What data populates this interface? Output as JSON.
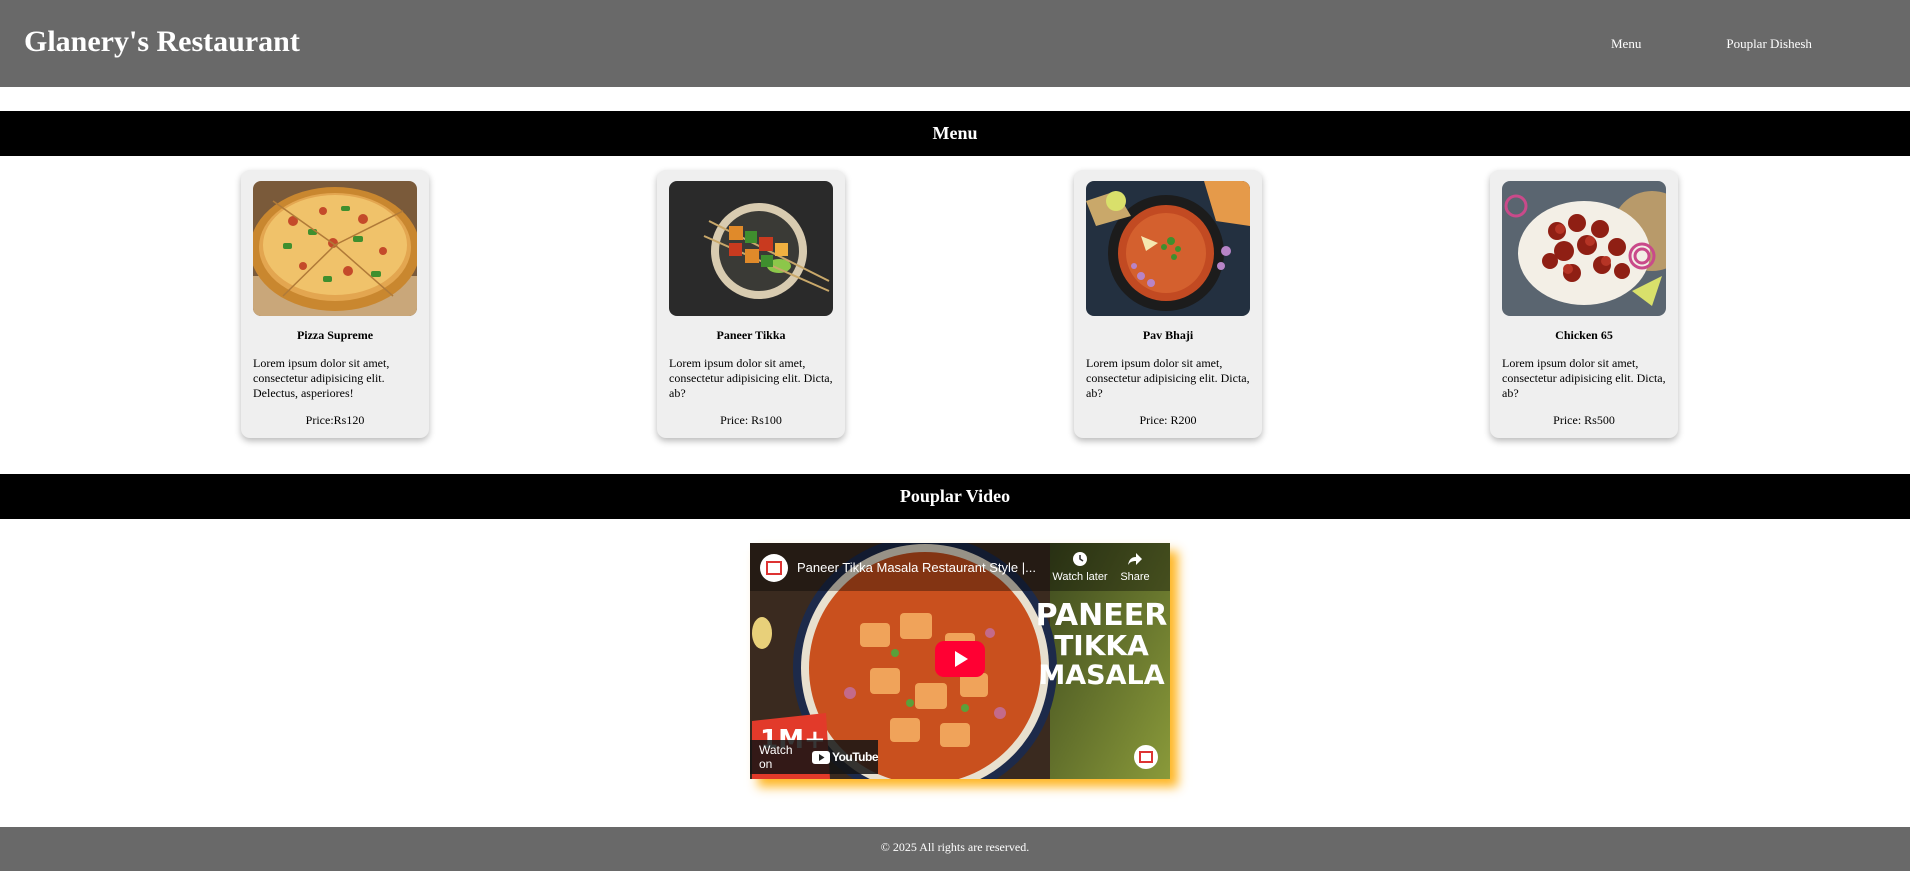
{
  "header": {
    "title": "Glanery's Restaurant",
    "nav": [
      "Menu",
      "Pouplar Dishesh"
    ]
  },
  "menu_section": {
    "heading": "Menu"
  },
  "dishes": [
    {
      "name": "Pizza Supreme",
      "description": "Lorem ipsum dolor sit amet, consectetur adipisicing elit. Delectus, asperiores!",
      "price": "Price:Rs120",
      "image": "pizza-image"
    },
    {
      "name": "Paneer Tikka",
      "description": "Lorem ipsum dolor sit amet, consectetur adipisicing elit. Dicta, ab?",
      "price": "Price: Rs100",
      "image": "paneer-tikka-image"
    },
    {
      "name": "Pav Bhaji",
      "description": "Lorem ipsum dolor sit amet, consectetur adipisicing elit. Dicta, ab?",
      "price": "Price: R200",
      "image": "pav-bhaji-image"
    },
    {
      "name": "Chicken 65",
      "description": "Lorem ipsum dolor sit amet, consectetur adipisicing elit. Dicta, ab?",
      "price": "Price: Rs500",
      "image": "chicken-65-image"
    }
  ],
  "video_section": {
    "heading": "Pouplar Video",
    "video_title": "Paneer Tikka Masala Restaurant Style |...",
    "watch_later": "Watch later",
    "share": "Share",
    "thumb_line1": "PANEER",
    "thumb_line2": "TIKKA",
    "thumb_line3": "MASALA",
    "badge": "1M+",
    "watch_on": "Watch on",
    "youtube": "YouTube"
  },
  "footer": {
    "text": "© 2025 All rights are reserved."
  }
}
